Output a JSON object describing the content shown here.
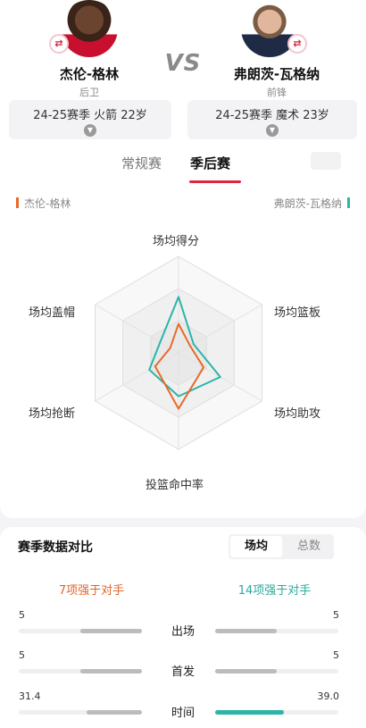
{
  "player_left": {
    "name": "杰伦-格林",
    "position": "后卫",
    "season_line": "24-25赛季 火箭 22岁",
    "swap_icon": "⇄",
    "accent": "#e86a2a"
  },
  "player_right": {
    "name": "弗朗茨-瓦格纳",
    "position": "前锋",
    "season_line": "24-25赛季 魔术 23岁",
    "swap_icon": "⇄",
    "accent": "#2bb5a8"
  },
  "vs_label": "VS",
  "tabs": {
    "regular": "常规赛",
    "playoff": "季后赛",
    "active": "playoff"
  },
  "legend": {
    "left": "杰伦-格林",
    "right": "弗朗茨-瓦格纳"
  },
  "radar": {
    "axes": [
      "场均得分",
      "场均篮板",
      "场均助攻",
      "投篮命中率",
      "场均抢断",
      "场均盖帽"
    ],
    "left_values": [
      0.3,
      0.14,
      0.3,
      0.58,
      0.28,
      0.1
    ],
    "right_values": [
      0.58,
      0.18,
      0.5,
      0.45,
      0.35,
      0.22
    ],
    "levels": 3
  },
  "comparison": {
    "title": "赛季数据对比",
    "segments": {
      "active": "场均",
      "inactive": "总数"
    },
    "advantage_left": "7项强于对手",
    "advantage_right": "14项强于对手",
    "rows": [
      {
        "label": "出场",
        "left": "5",
        "right": "5",
        "left_ratio": 0.5,
        "right_ratio": 0.5,
        "right_leads": false
      },
      {
        "label": "首发",
        "left": "5",
        "right": "5",
        "left_ratio": 0.5,
        "right_ratio": 0.5,
        "right_leads": false
      },
      {
        "label": "时间",
        "left": "31.4",
        "right": "39.0",
        "left_ratio": 0.45,
        "right_ratio": 0.56,
        "right_leads": true
      }
    ]
  },
  "colors": {
    "brand_red": "#e1253e",
    "orange": "#e86a2a",
    "teal": "#2bb5a8",
    "grey_fill": "#bcbcbc"
  }
}
